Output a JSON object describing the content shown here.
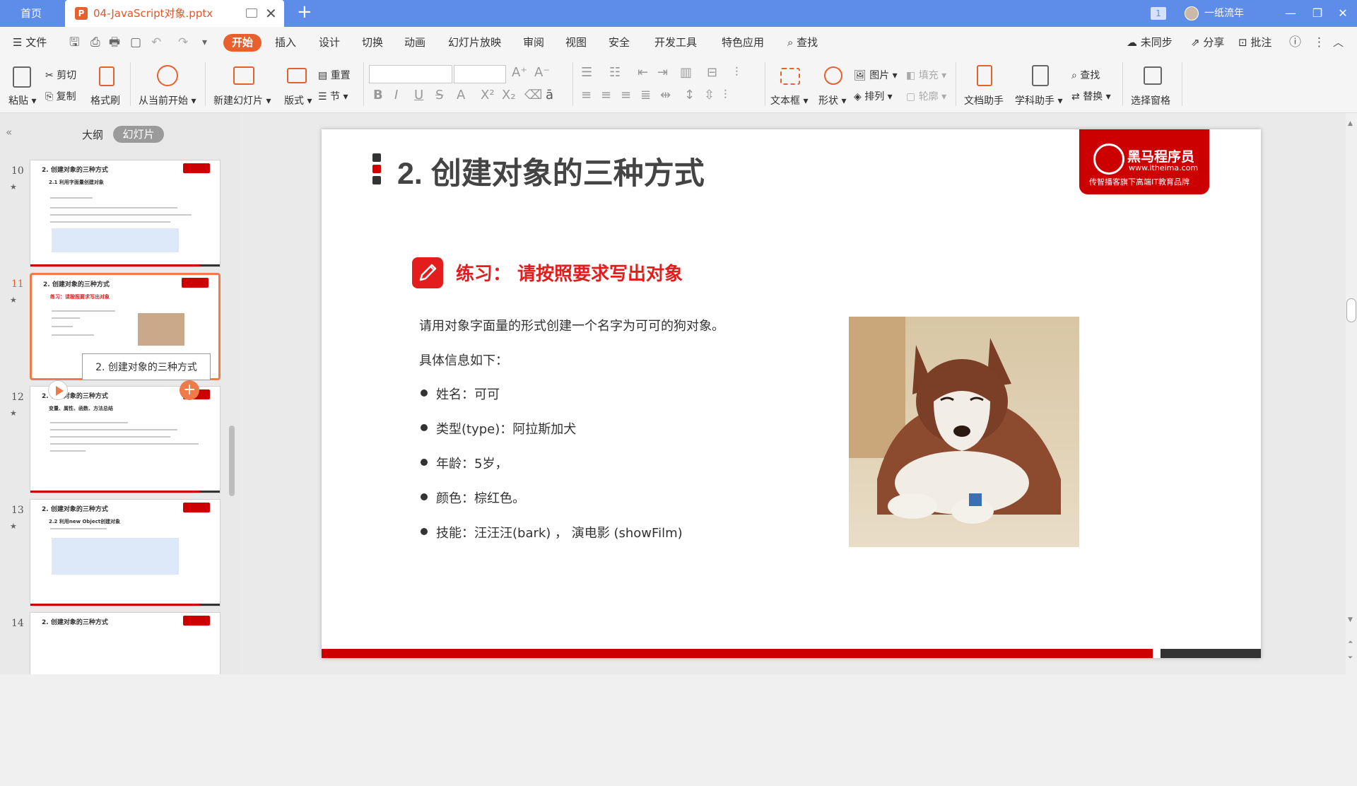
{
  "titlebar": {
    "home_tab": "首页",
    "doc_tab": "04-JavaScript对象.pptx",
    "window_count": "1",
    "username": "一纸流年"
  },
  "menu": {
    "file": "文件",
    "items": [
      "开始",
      "插入",
      "设计",
      "切换",
      "动画",
      "幻灯片放映",
      "审阅",
      "视图",
      "安全",
      "开发工具",
      "特色应用"
    ],
    "search": "查找",
    "sync": "未同步",
    "share": "分享",
    "annotate": "批注"
  },
  "ribbon": {
    "paste": "粘贴",
    "cut": "剪切",
    "copy": "复制",
    "format_painter": "格式刷",
    "from_current": "从当前开始",
    "new_slide": "新建幻灯片",
    "layout": "版式",
    "reset": "重置",
    "section": "节",
    "textbox": "文本框",
    "shape": "形状",
    "picture": "图片",
    "fill": "填充",
    "arrange": "排列",
    "outline": "轮廓",
    "doc_assistant": "文档助手",
    "subject_assistant": "学科助手",
    "find": "查找",
    "replace": "替换",
    "select_pane": "选择窗格"
  },
  "sidebar": {
    "tab_outline": "大纲",
    "tab_slides": "幻灯片",
    "tooltip": "2. 创建对象的三种方式",
    "thumbs": [
      {
        "num": "10",
        "title": "2. 创建对象的三种方式",
        "sub": "2.1 利用字面量创建对象"
      },
      {
        "num": "11",
        "title": "2. 创建对象的三种方式",
        "sub": "练习：请按照要求写出对象"
      },
      {
        "num": "12",
        "title": "2. 创建对象的三种方式",
        "sub": "变量、属性、函数、方法总结"
      },
      {
        "num": "13",
        "title": "2. 创建对象的三种方式",
        "sub": "2.2 利用new Object创建对象"
      },
      {
        "num": "14",
        "title": "2. 创建对象的三种方式",
        "sub": ""
      }
    ]
  },
  "slide": {
    "title": "2. 创建对象的三种方式",
    "logo_name": "黑马程序员",
    "logo_url": "www.itheima.com",
    "logo_tagline": "传智播客旗下高端IT教育品牌",
    "exercise_title": "练习：  请按照要求写出对象",
    "intro": "请用对象字面量的形式创建一个名字为可可的狗对象。",
    "info_label": "具体信息如下：",
    "bullets": [
      "姓名：可可",
      "类型(type)：阿拉斯加犬",
      "年龄：5岁，",
      "颜色：棕红色。",
      "技能：汪汪汪(bark) ， 演电影 (showFilm)"
    ]
  },
  "colors": {
    "titlebar": "#5d8de8",
    "accent": "#e8602e",
    "brand_red": "#cc0000"
  }
}
